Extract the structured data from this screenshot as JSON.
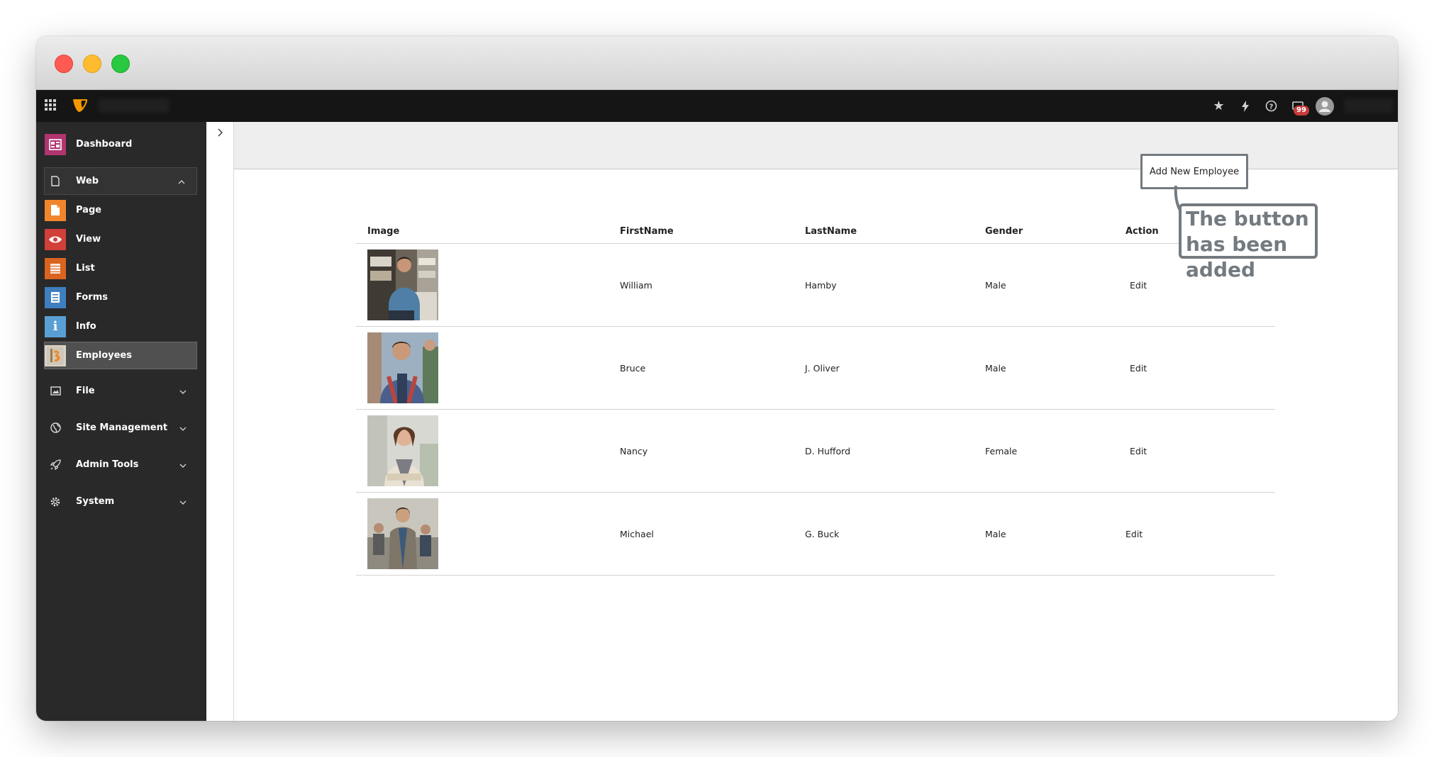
{
  "sidebar": {
    "dashboard": "Dashboard",
    "web": "Web",
    "web_items": [
      "Page",
      "View",
      "List",
      "Forms",
      "Info",
      "Employees"
    ],
    "file": "File",
    "site_management": "Site Management",
    "admin_tools": "Admin Tools",
    "system": "System"
  },
  "toolbar": {
    "notification_count": "99"
  },
  "table": {
    "headers": {
      "image": "Image",
      "first": "FirstName",
      "last": "LastName",
      "gender": "Gender",
      "action": "Action"
    },
    "rows": [
      {
        "first": "William",
        "last": "Hamby",
        "gender": "Male",
        "action": "Edit"
      },
      {
        "first": "Bruce",
        "last": "J. Oliver",
        "gender": "Male",
        "action": "Edit"
      },
      {
        "first": "Nancy",
        "last": "D. Hufford",
        "gender": "Female",
        "action": "Edit"
      },
      {
        "first": "Michael",
        "last": "G. Buck",
        "gender": "Male",
        "action": "Edit"
      }
    ]
  },
  "add_button": "Add New Employee",
  "callout": {
    "line1": "The button",
    "line2": "has been added"
  },
  "colors": {
    "dashboard_icon": "#b13571",
    "page_icon": "#f0852d",
    "view_icon": "#d13f39",
    "list_icon": "#d9631f",
    "forms_icon": "#3f7fbf",
    "info_icon": "#5a9fd4",
    "badge": "#c83c3c",
    "annotation": "#737a80"
  }
}
